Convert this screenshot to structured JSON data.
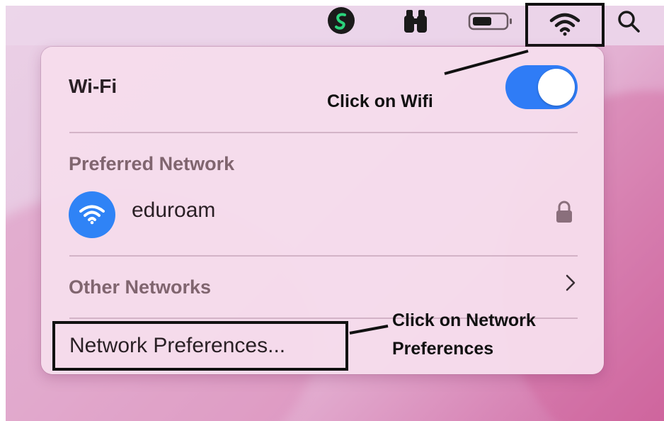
{
  "menubar": {
    "icons": [
      "shield-s-app-icon",
      "binoculars-icon",
      "battery-icon",
      "wifi-icon",
      "search-icon"
    ]
  },
  "wifi_panel": {
    "title": "Wi-Fi",
    "toggle_state": "on",
    "preferred_label": "Preferred Network",
    "network": {
      "name": "eduroam",
      "secured": true
    },
    "other_label": "Other Networks",
    "prefs_label": "Network Preferences..."
  },
  "annotations": {
    "wifi_note": "Click on Wifi",
    "prefs_note_line1": "Click on Network",
    "prefs_note_line2": "Preferences"
  },
  "colors": {
    "accent": "#2f7cf6",
    "wifi_icon_bg": "#2f83f6",
    "section_text": "#80656f"
  }
}
